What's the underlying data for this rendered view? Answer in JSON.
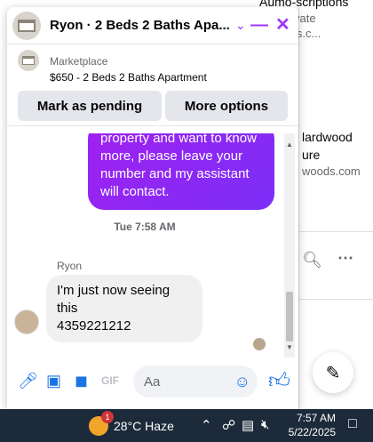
{
  "background_page": {
    "top_item": {
      "line1": "Aumo-scriptions",
      "line2": "ers.elevate",
      "line3": "criptions.c..."
    },
    "mid_item": {
      "line1": "lardwood",
      "line2": "ure",
      "line3": "woods.com"
    }
  },
  "chat": {
    "title": "Ryon · 2 Beds 2 Baths Apa...",
    "marketplace": {
      "category": "Marketplace",
      "listing": "$650 - 2 Beds 2 Baths Apartment",
      "primary_button": "Mark as pending",
      "secondary_button": "More options"
    },
    "outgoing_message": "property and want to know more, please leave your number and my assistant will contact.",
    "timestamp": "Tue 7:58 AM",
    "incoming": {
      "sender": "Ryon",
      "message_line1": "I'm just now seeing this",
      "message_line2": "4359221212"
    },
    "composer": {
      "placeholder": "Aa"
    }
  },
  "taskbar": {
    "weather": "28°C  Haze",
    "weather_badge": "1",
    "time": "7:57 AM",
    "date": "5/22/2025"
  },
  "colors": {
    "accent": "#a033ff",
    "messenger_blue": "#1b74e4",
    "taskbar": "#1c2a3a"
  }
}
